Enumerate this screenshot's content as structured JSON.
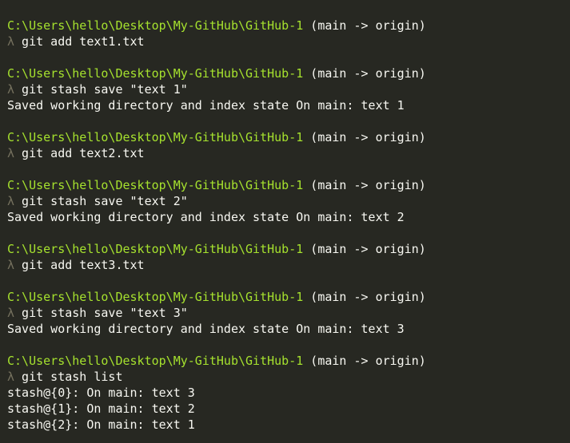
{
  "prompt_path": "C:\\Users\\hello\\Desktop\\My-GitHub\\GitHub-1",
  "branch_label": "(main -> origin)",
  "lambda": "λ",
  "blocks": [
    {
      "command": "git add text1.txt",
      "output": []
    },
    {
      "command": "git stash save \"text 1\"",
      "output": [
        "Saved working directory and index state On main: text 1"
      ]
    },
    {
      "command": "git add text2.txt",
      "output": []
    },
    {
      "command": "git stash save \"text 2\"",
      "output": [
        "Saved working directory and index state On main: text 2"
      ]
    },
    {
      "command": "git add text3.txt",
      "output": []
    },
    {
      "command": "git stash save \"text 3\"",
      "output": [
        "Saved working directory and index state On main: text 3"
      ]
    },
    {
      "command": "git stash list",
      "output": [
        "stash@{0}: On main: text 3",
        "stash@{1}: On main: text 2",
        "stash@{2}: On main: text 1"
      ]
    }
  ],
  "colors": {
    "background": "#272822",
    "path": "#a6e22e",
    "text": "#f8f8f2",
    "lambda": "#75715e"
  }
}
